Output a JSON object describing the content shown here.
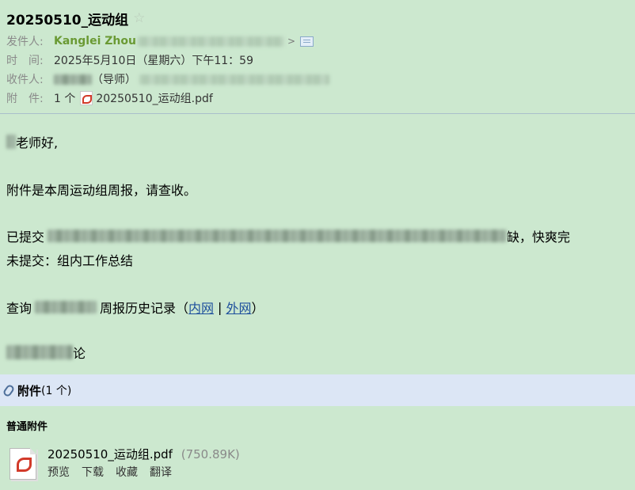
{
  "email": {
    "subject": "20250510_运动组",
    "star_icon": "☆",
    "from_label": "发件人:",
    "from_name": "Kanglei Zhou",
    "from_arrow": ">",
    "time_label": "时　间:",
    "time_value": "2025年5月10日（星期六）下午11：59",
    "to_label": "收件人:",
    "to_value": "（导师）",
    "attach_label": "附　件:",
    "attach_count": "1 个",
    "attach_file": "20250510_运动组.pdf"
  },
  "body": {
    "greeting": "老师好,",
    "line1": "附件是本周运动组周报，请查收。",
    "submitted_prefix": "已提交",
    "submitted_suffix": "缺，快爽完",
    "not_submitted": "未提交：组内工作总结",
    "query_prefix": "查询",
    "query_mid": "周报历史记录（",
    "link_intranet": "内网",
    "link_sep": "|",
    "link_extranet": "外网",
    "query_end": "）",
    "sign": "论"
  },
  "attachments": {
    "title": "附件",
    "count": "(1 个)",
    "type_label": "普通附件",
    "file_name": "20250510_运动组.pdf",
    "file_size": "(750.89K)",
    "actions": [
      "预览",
      "下载",
      "收藏",
      "翻译"
    ]
  },
  "colors": {
    "background": "#cce8cf",
    "sender": "#6a9a34",
    "link": "#1d4f9c",
    "attach_bar": "#dce6f5",
    "pdf_red": "#d23a2a"
  },
  "icons": {
    "star": "star-icon",
    "contact": "contact-card-icon",
    "pdf": "pdf-icon",
    "paperclip": "paperclip-icon"
  }
}
